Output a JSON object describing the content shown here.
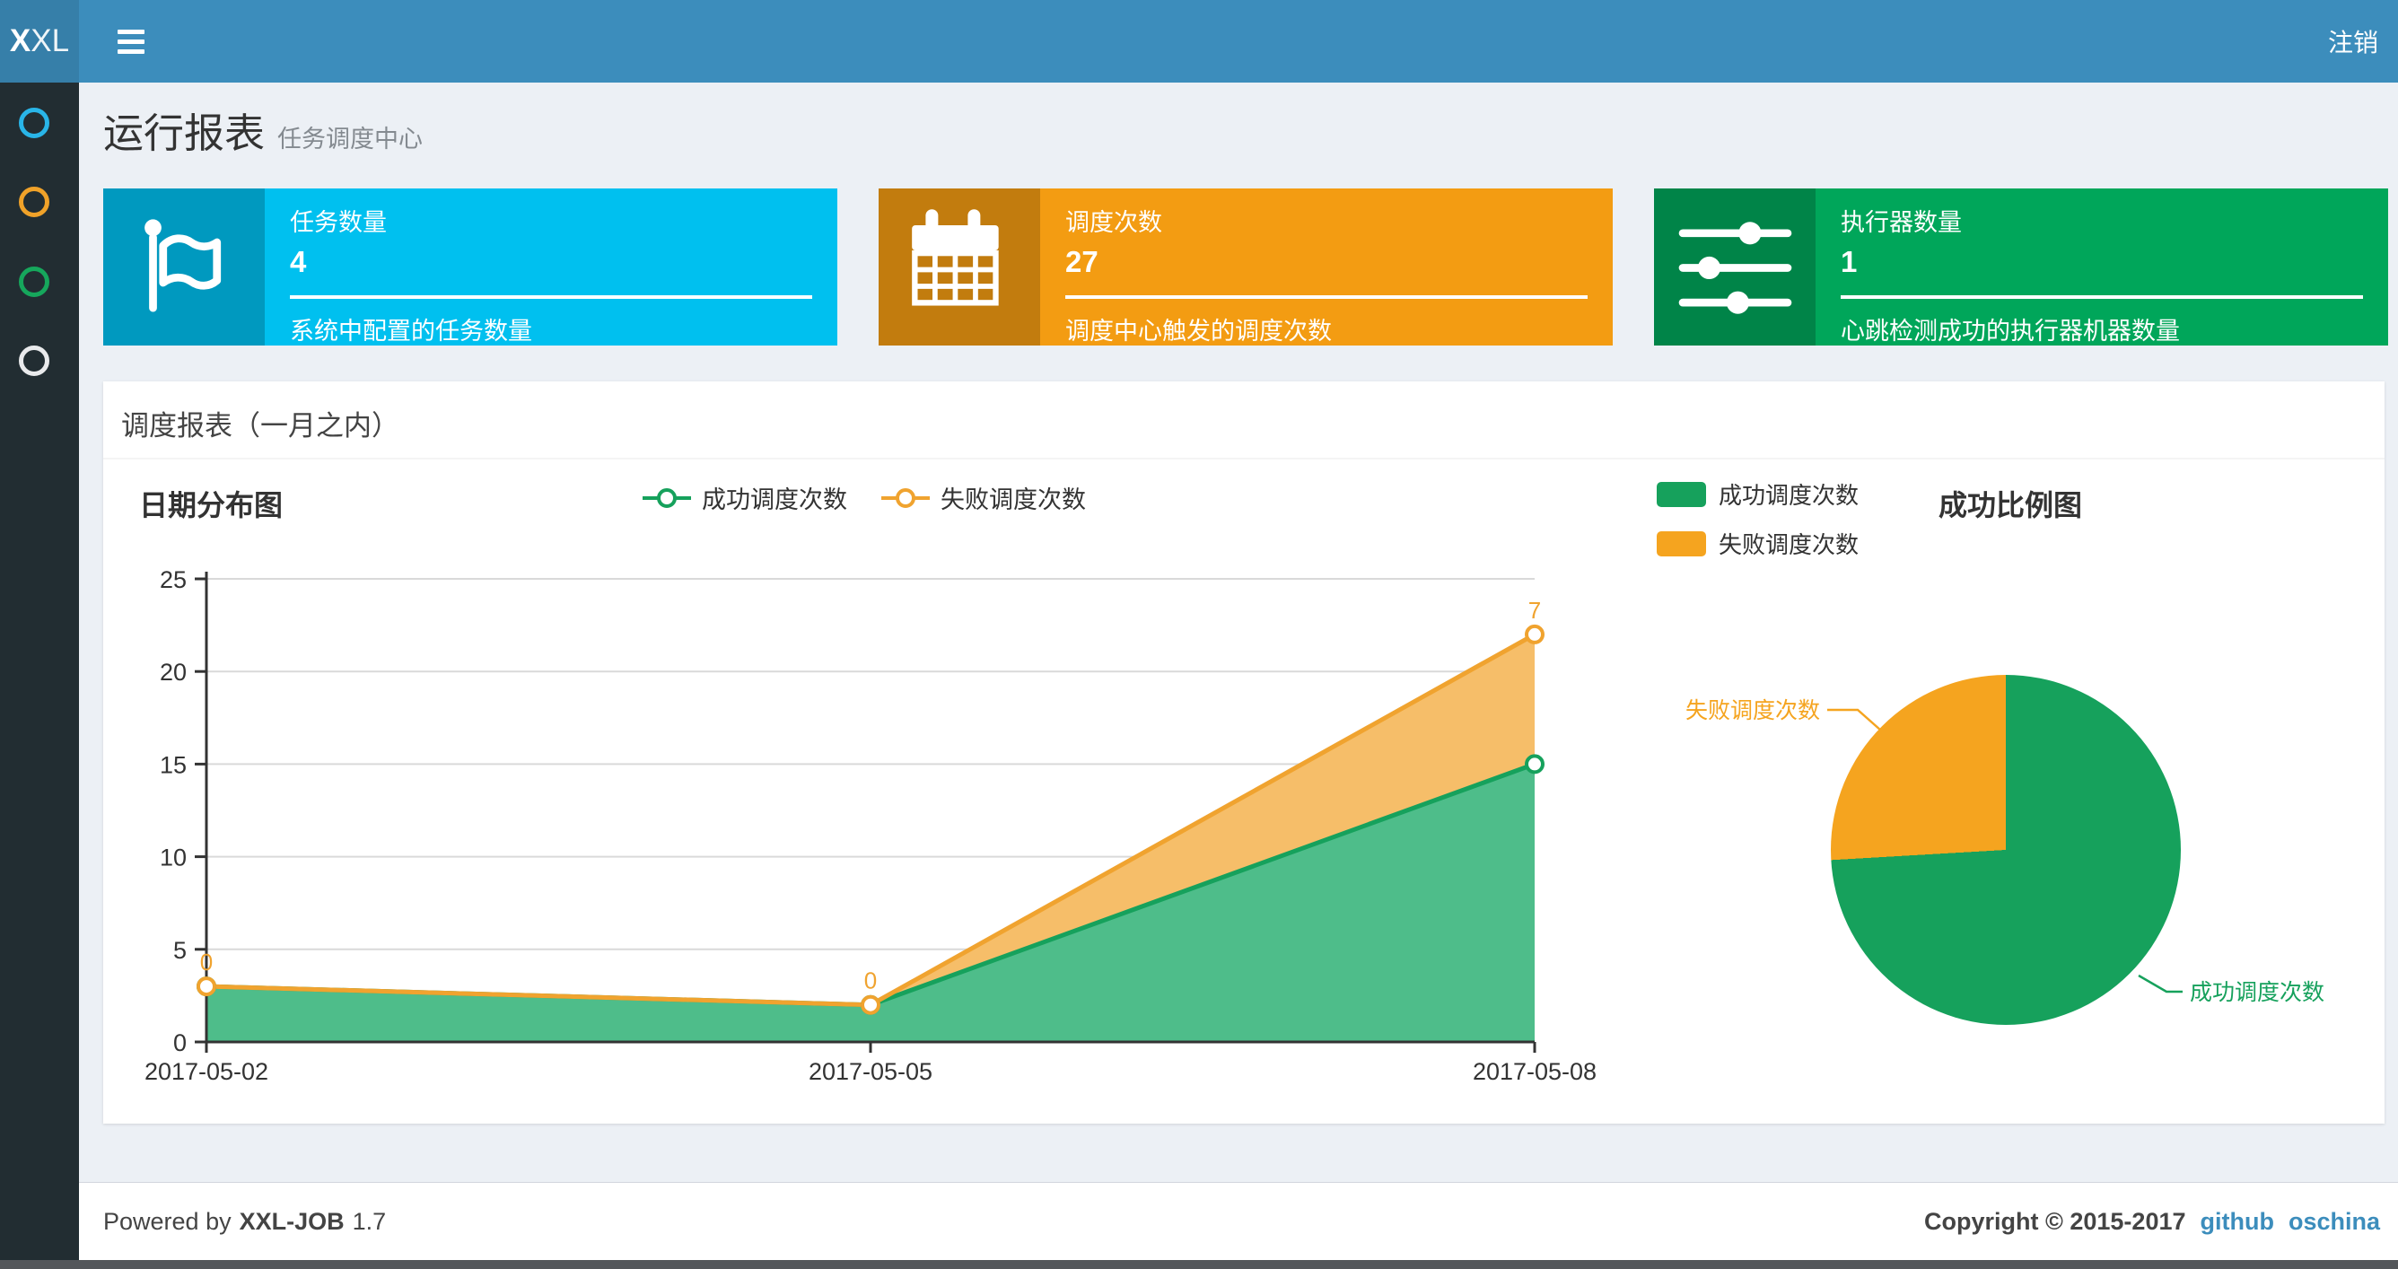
{
  "theme": {
    "navbar_bg": "#3c8dbc",
    "logo_bg": "#367fa9",
    "sidebar_bg": "#222d32",
    "content_bg": "#ecf0f5",
    "link_color": "#3c8dbc"
  },
  "navbar": {
    "logo_bold": "X",
    "logo_rest": "XL",
    "menu_icon": "hamburger-menu-icon",
    "logout_label": "注销"
  },
  "sidebar": {
    "items": [
      {
        "icon": "circle-outline-icon",
        "color": "#29b5e8"
      },
      {
        "icon": "circle-outline-icon",
        "color": "#f0a229"
      },
      {
        "icon": "circle-outline-icon",
        "color": "#16a75c"
      },
      {
        "icon": "circle-outline-icon",
        "color": "#e9eaec"
      }
    ]
  },
  "page_header": {
    "title": "运行报表",
    "subtitle": "任务调度中心"
  },
  "info_boxes": [
    {
      "icon": "flag-icon",
      "label": "任务数量",
      "value": "4",
      "desc": "系统中配置的任务数量",
      "color": "#00c0ef"
    },
    {
      "icon": "calendar-icon",
      "label": "调度次数",
      "value": "27",
      "desc": "调度中心触发的调度次数",
      "color": "#f39c12"
    },
    {
      "icon": "sliders-icon",
      "label": "执行器数量",
      "value": "1",
      "desc": "心跳检测成功的执行器机器数量",
      "color": "#00a65a"
    }
  ],
  "panel": {
    "title": "调度报表（一月之内）"
  },
  "chart_data": [
    {
      "type": "area",
      "title": "日期分布图",
      "x": [
        "2017-05-02",
        "2017-05-05",
        "2017-05-08"
      ],
      "series": [
        {
          "name": "成功调度次数",
          "values": [
            3,
            2,
            15
          ],
          "color": "#16a15c",
          "fill": "#4ebd8a"
        },
        {
          "name": "失败调度次数",
          "values": [
            0,
            0,
            7
          ],
          "color": "#f0a32f",
          "fill": "#f6be69"
        }
      ],
      "stacked": true,
      "point_labels": {
        "series": "失败调度次数",
        "values": [
          "0",
          "0",
          "7"
        ]
      },
      "ylim": [
        0,
        25
      ],
      "yticks": [
        0,
        5,
        10,
        15,
        20,
        25
      ],
      "grid": true,
      "legend_position": "top-center"
    },
    {
      "type": "pie",
      "title": "成功比例图",
      "slices": [
        {
          "label": "成功调度次数",
          "value": 20,
          "color": "#16a15c"
        },
        {
          "label": "失败调度次数",
          "value": 7,
          "color": "#f5a41f"
        }
      ],
      "legend_position": "top-left",
      "start_angle_deg": 90,
      "direction": "clockwise"
    }
  ],
  "footer": {
    "powered_by": "Powered by",
    "product": "XXL-JOB",
    "version": "1.7",
    "copyright": "Copyright © 2015-2017",
    "links": [
      "github",
      "oschina"
    ]
  }
}
